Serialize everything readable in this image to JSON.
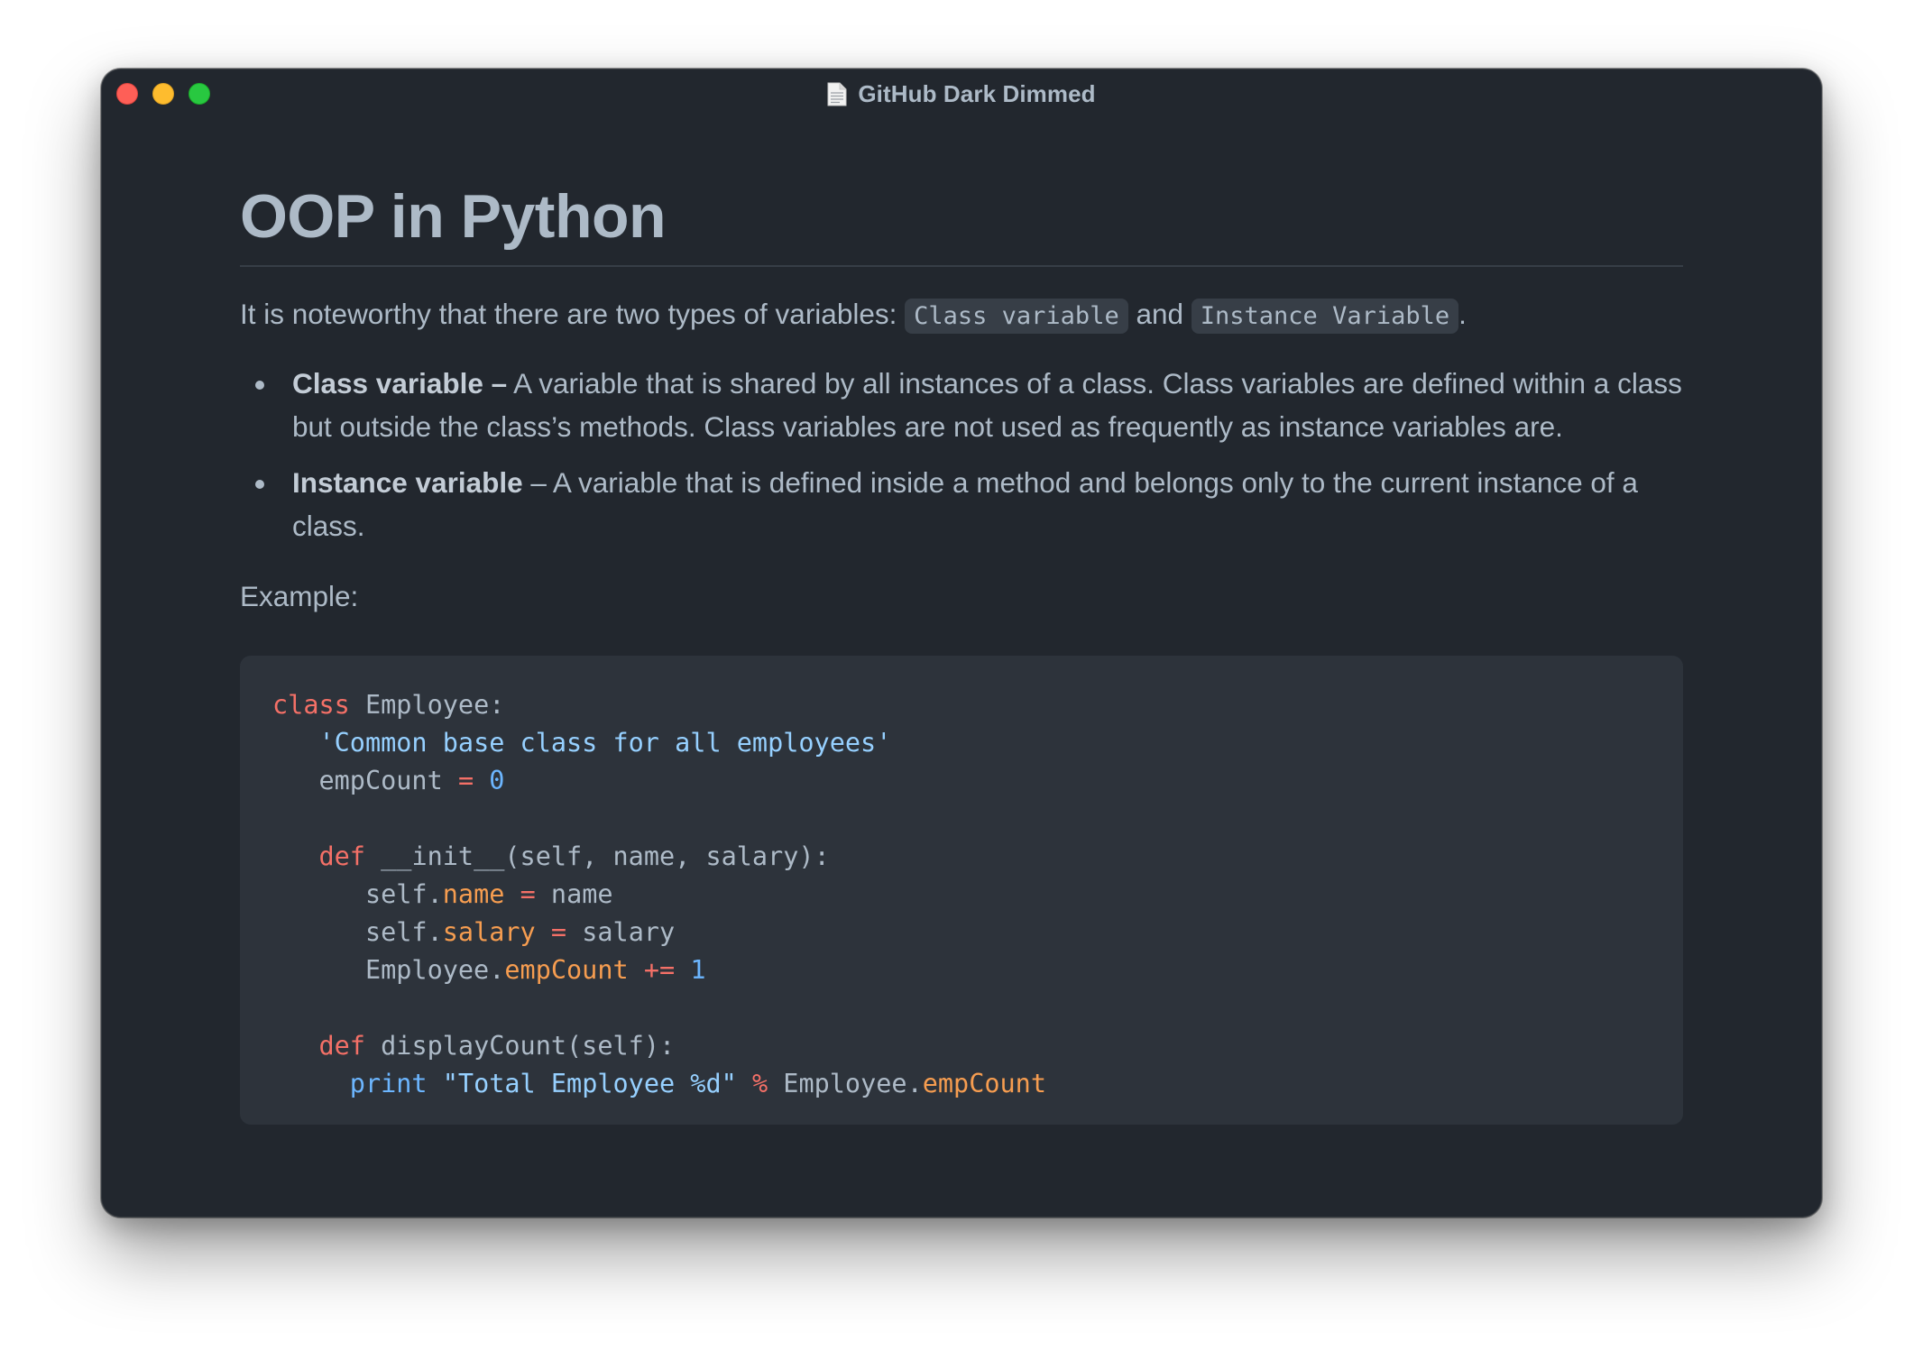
{
  "window": {
    "title": "GitHub Dark Dimmed",
    "icon": "document-icon",
    "controls": [
      "close",
      "minimize",
      "maximize"
    ],
    "colors": {
      "background": "#22272e",
      "text": "#adbac7",
      "code_background": "#2d333b",
      "keyword": "#f47067",
      "string": "#96d0ff",
      "number": "#6cb6ff",
      "attribute": "#f69d50"
    }
  },
  "doc": {
    "heading": "OOP in Python",
    "intro": {
      "before": "It is noteworthy that there are two types of variables: ",
      "code1": "Class variable",
      "middle": " and ",
      "code2": "Instance Variable",
      "after": "."
    },
    "bullets": [
      {
        "term": "Class variable –",
        "text": " A variable that is shared by all instances of a class. Class variables are defined within a class but outside the class’s methods. Class variables are not used as frequently as instance variables are."
      },
      {
        "term": "Instance variable",
        "text": " – A variable that is defined inside a method and belongs only to the current instance of a class."
      }
    ],
    "example_label": "Example:",
    "code": {
      "l1_kw": "class",
      "l1_rest": " Employee:",
      "l2_str": "'Common base class for all employees'",
      "l3_name": "empCount",
      "l3_op": "=",
      "l3_num": "0",
      "l5_kw": "def",
      "l5_rest": " __init__(self, name, salary):",
      "l6_obj": "self.",
      "l6_attr": "name",
      "l6_op": "=",
      "l6_val": "name",
      "l7_obj": "self.",
      "l7_attr": "salary",
      "l7_op": "=",
      "l7_val": "salary",
      "l8_obj": "Employee.",
      "l8_attr": "empCount",
      "l8_op": "+=",
      "l8_num": "1",
      "l10_kw": "def",
      "l10_rest": " displayCount(self):",
      "l11_bi": "print",
      "l11_str": "\"Total Employee %d\"",
      "l11_op": "%",
      "l11_obj": "Employee.",
      "l11_attr": "empCount"
    }
  }
}
